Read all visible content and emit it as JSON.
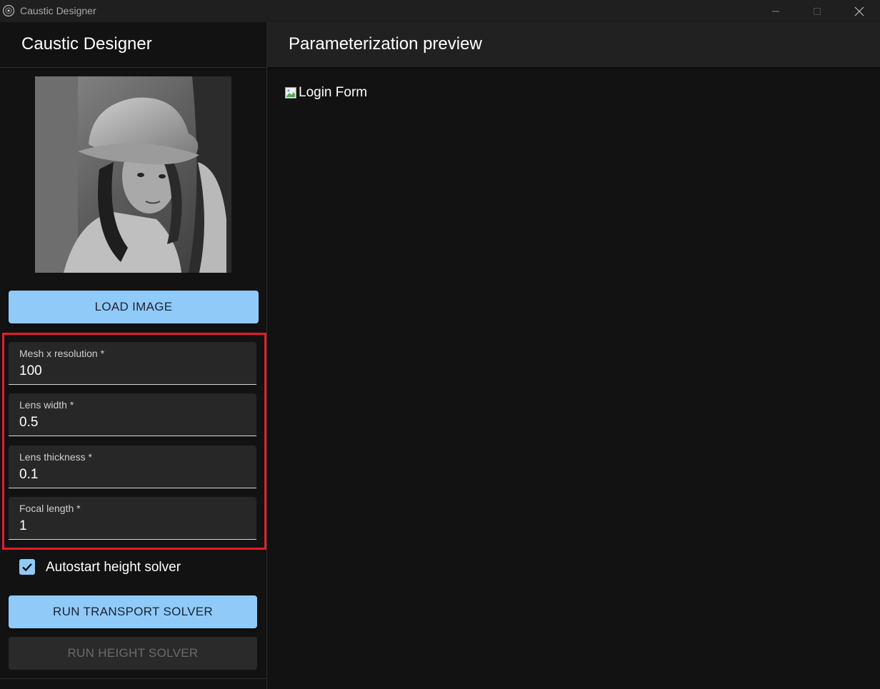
{
  "window": {
    "title": "Caustic Designer"
  },
  "sidebar": {
    "title": "Caustic Designer",
    "load_button": "LOAD IMAGE",
    "fields": [
      {
        "label": "Mesh x resolution *",
        "value": "100"
      },
      {
        "label": "Lens width *",
        "value": "0.5"
      },
      {
        "label": "Lens thickness *",
        "value": "0.1"
      },
      {
        "label": "Focal length *",
        "value": "1"
      }
    ],
    "autostart": {
      "label": "Autostart height solver",
      "checked": true
    },
    "transport_button": "RUN TRANSPORT SOLVER",
    "height_button": "RUN HEIGHT SOLVER"
  },
  "main": {
    "title": "Parameterization preview",
    "image_alt": "Login Form"
  },
  "colors": {
    "accent": "#90caf9",
    "highlight": "#e0202a",
    "background": "#121212"
  }
}
